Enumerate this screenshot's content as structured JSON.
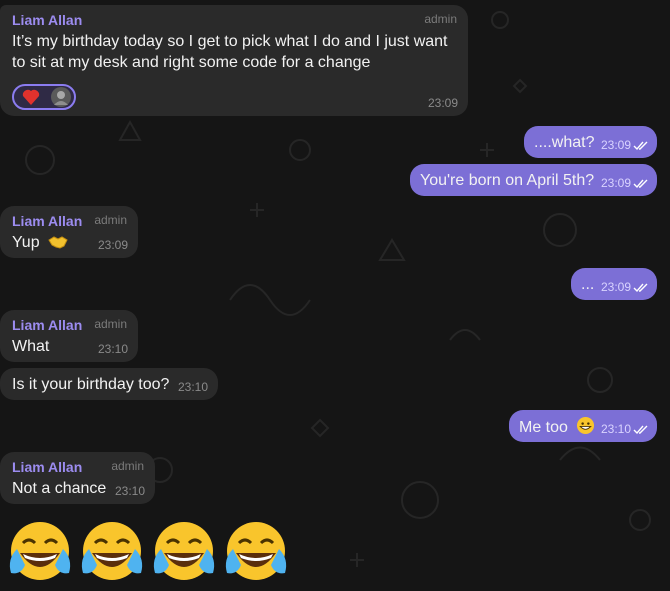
{
  "chat": {
    "messages": [
      {
        "direction": "incoming",
        "sender": "Liam Allan",
        "role": "admin",
        "text": "It’s my birthday today so I get to pick what I do and I just want to sit at my desk and right some code for a change",
        "time": "23:09",
        "reactions": [
          "red-heart",
          "avatar"
        ]
      },
      {
        "direction": "outgoing",
        "text": "....what?",
        "time": "23:09",
        "status": "read"
      },
      {
        "direction": "outgoing",
        "text": "You're born on April 5th?",
        "time": "23:09",
        "status": "read"
      },
      {
        "direction": "incoming",
        "sender": "Liam Allan",
        "role": "admin",
        "text": "Yup",
        "emoji": "handshake",
        "time": "23:09"
      },
      {
        "direction": "outgoing",
        "text": "...",
        "time": "23:09",
        "status": "read"
      },
      {
        "direction": "incoming",
        "sender": "Liam Allan",
        "role": "admin",
        "text": "What",
        "time": "23:10"
      },
      {
        "direction": "incoming",
        "text": "Is it your birthday too?",
        "time": "23:10"
      },
      {
        "direction": "outgoing",
        "text": "Me too",
        "emoji": "grinning-face",
        "time": "23:10",
        "status": "read"
      },
      {
        "direction": "incoming",
        "sender": "Liam Allan",
        "role": "admin",
        "text": "Not a chance",
        "time": "23:10"
      },
      {
        "direction": "incoming",
        "emoji_only": [
          "face-with-tears-of-joy",
          "face-with-tears-of-joy",
          "face-with-tears-of-joy",
          "face-with-tears-of-joy"
        ]
      }
    ]
  },
  "colors": {
    "background": "#151515",
    "incoming_bubble": "#2a2a2a",
    "outgoing_bubble": "#7c6fd6",
    "sender_name": "#9c8cf0",
    "reaction_border": "#8b7cf0"
  }
}
